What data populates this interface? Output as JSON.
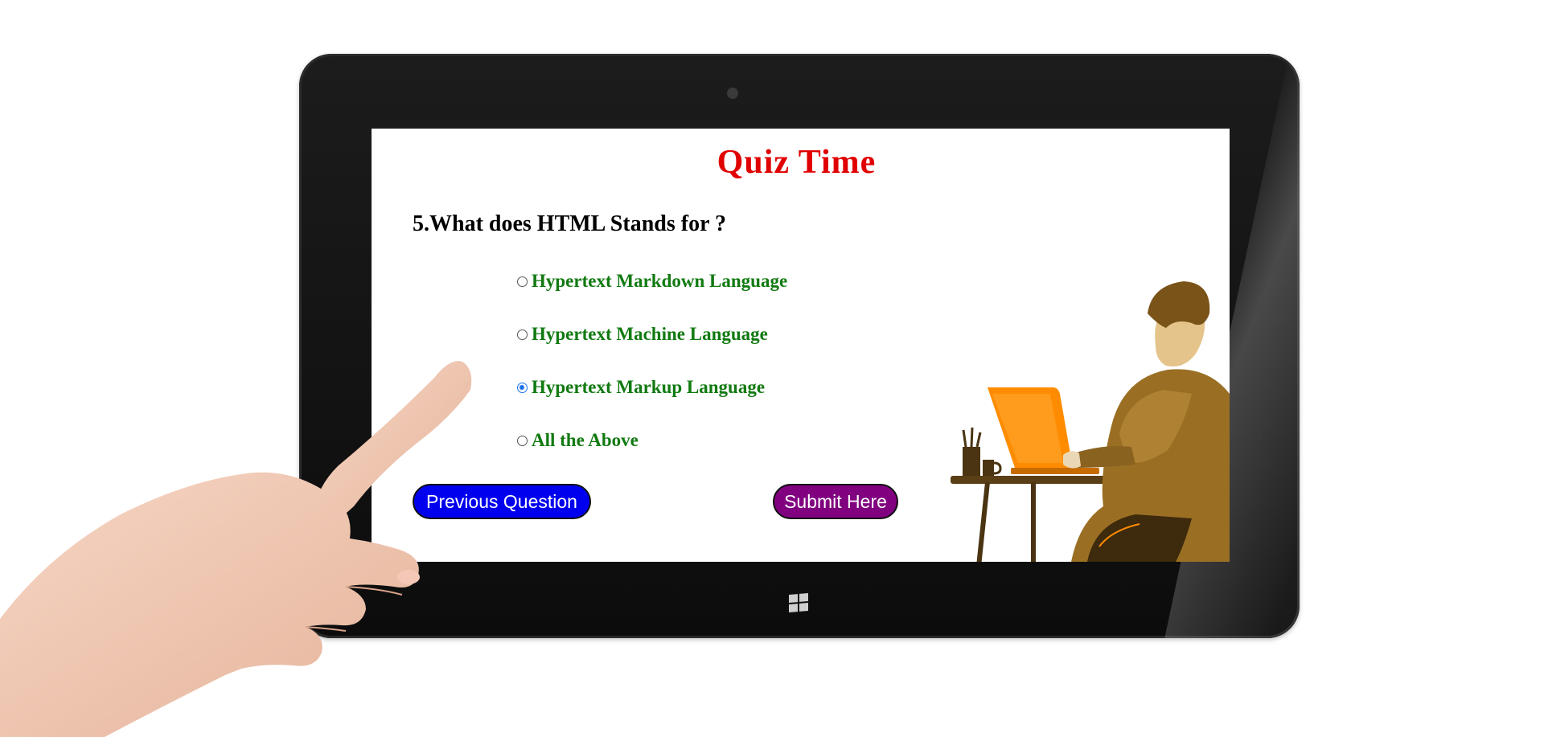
{
  "quiz": {
    "title": "Quiz Time",
    "question": "5.What does HTML Stands for ?",
    "options": [
      {
        "label": "Hypertext Markdown Language",
        "selected": false
      },
      {
        "label": "Hypertext Machine Language",
        "selected": false
      },
      {
        "label": "Hypertext Markup Language",
        "selected": true
      },
      {
        "label": "All the Above",
        "selected": false
      }
    ],
    "buttons": {
      "previous_label": "Previous Question",
      "submit_label": "Submit Here"
    }
  },
  "colors": {
    "title": "#e00000",
    "option_text": "#117a11",
    "previous_button": "#0000ee",
    "submit_button": "#800080",
    "laptop": "#ff8c00",
    "person": "#9a6f24"
  }
}
